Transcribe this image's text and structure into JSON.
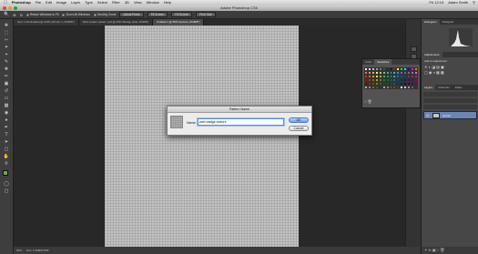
{
  "menubar": {
    "apple": "",
    "app": "Photoshop",
    "items": [
      "File",
      "Edit",
      "Image",
      "Layer",
      "Type",
      "Select",
      "Filter",
      "3D",
      "View",
      "Window",
      "Help"
    ],
    "time": "Fri 12:13",
    "user": "Adam Smith"
  },
  "window": {
    "title": "Adobe Photoshop CS6"
  },
  "options_bar": {
    "checkboxes": [
      "Resize Windows to Fit",
      "Zoom All Windows",
      "Scrubby Zoom"
    ],
    "buttons": [
      "Actual Pixels",
      "Fit Screen",
      "Fill Screen",
      "Print Size"
    ]
  },
  "doc_tabs": [
    {
      "label": "Sect 1 Workstation@ 100% (#Color 1, RGB/8*)",
      "active": false
    },
    {
      "label": "Web header pattern.psd @ 25% (Badge plate, RGB/8)",
      "active": false
    },
    {
      "label": "Untitled-1 @ 50% (texture, RGB/8*)",
      "active": true
    }
  ],
  "status": {
    "zoom": "50%",
    "doc": "Doc: 5.49M/8.35M"
  },
  "right_panel": {
    "top_tabs": [
      "Histogram",
      "Navigator"
    ],
    "adjustments": {
      "tabs": [
        "Adjustments"
      ],
      "label": "Add an adjustment"
    },
    "layers": {
      "tabs": [
        "Layers",
        "Channels",
        "Paths"
      ],
      "layer_name": "texture"
    }
  },
  "swatches_panel": {
    "tabs": [
      "Color",
      "Swatches"
    ],
    "colors": [
      "#ffffff",
      "#e6e6e6",
      "#c8c8c8",
      "#a0a0a0",
      "#787878",
      "#505050",
      "#2a2a2a",
      "#000000",
      "#ff0000",
      "#ffff00",
      "#00ff00",
      "#00ffff",
      "#0000ff",
      "#ff00ff",
      "#ff8000",
      "#f26c4f",
      "#f68e55",
      "#fbaf5c",
      "#fff467",
      "#acd372",
      "#7dc473",
      "#3cb878",
      "#1cbbb4",
      "#00bff3",
      "#438ccb",
      "#5574b9",
      "#605ca8",
      "#855fa8",
      "#a763a8",
      "#f06ea9",
      "#ed1c24",
      "#f26522",
      "#f7941d",
      "#fff200",
      "#8dc63f",
      "#39b54a",
      "#00a651",
      "#00a99d",
      "#00aeef",
      "#0072bc",
      "#0054a6",
      "#2e3192",
      "#662d91",
      "#92278f",
      "#ec008c",
      "#9e0b0f",
      "#a0410d",
      "#a36209",
      "#aba000",
      "#598527",
      "#1a7b30",
      "#007236",
      "#00746b",
      "#0076a3",
      "#004b80",
      "#003471",
      "#1b1464",
      "#440e62",
      "#630460",
      "#9e005d",
      "#790000",
      "#7b2e00",
      "#7d4900",
      "#827b00",
      "#406618",
      "#005e20",
      "#005826",
      "#005952",
      "#005b7f",
      "#003663",
      "#002157",
      "#0d004c",
      "#32004b",
      "#4b0049",
      "#7b0046",
      "#c7b299",
      "#998675",
      "#736357",
      "#534741",
      "#37302d",
      "#c69c6d",
      "#a67c52",
      "#8c6239",
      "#754c24",
      "#603913",
      "#e6e6e6",
      "#cccccc",
      "#999999",
      "#666666",
      "#333333"
    ]
  },
  "dialog": {
    "title": "Pattern Name",
    "name_label": "Name:",
    "name_value": "web badge texture",
    "ok": "OK",
    "cancel": "Cancel"
  },
  "colors": {
    "foreground": "#6ea84a",
    "background": "#ffffff",
    "canvas": "#c4c4c4",
    "ok_blue": "#5f9ef7"
  }
}
